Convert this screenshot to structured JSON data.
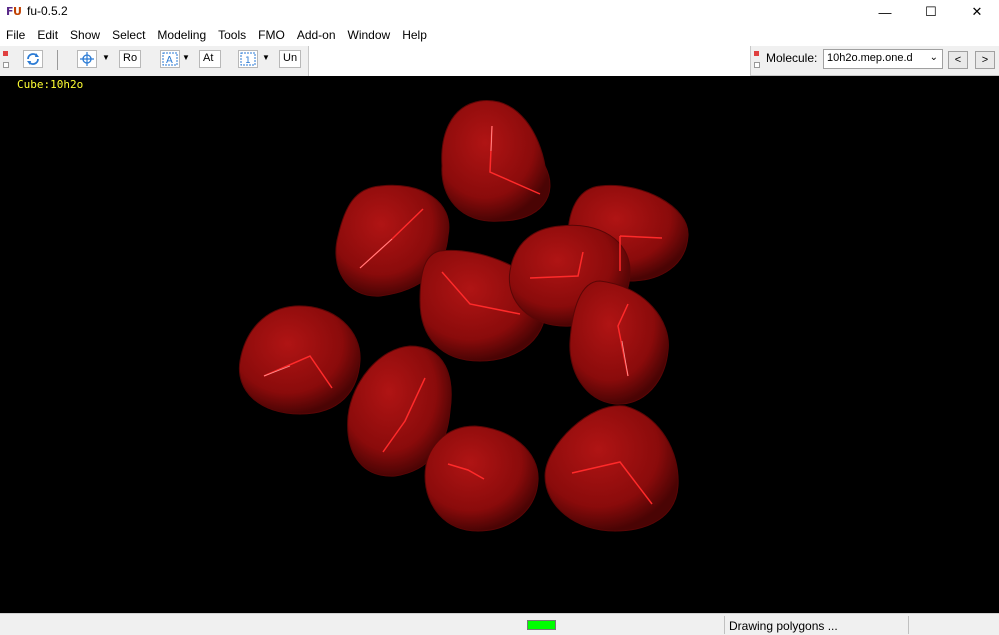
{
  "window": {
    "title": "fu-0.5.2",
    "minimize": "—",
    "maximize": "☐",
    "close": "✕"
  },
  "menu": [
    "File",
    "Edit",
    "Show",
    "Select",
    "Modeling",
    "Tools",
    "FMO",
    "Add-on",
    "Window",
    "Help"
  ],
  "toolbar": {
    "ro_label": "Ro",
    "at_label": "At",
    "un_label": "Un"
  },
  "molecule_bar": {
    "label": "Molecule:",
    "selected": "10h2o.mep.one.d",
    "prev": "<",
    "next": ">"
  },
  "viewport": {
    "cube_label": "Cube:10h2o",
    "surface_color": "#8e0b0b",
    "bond_color": "#ff2a2a"
  },
  "status": {
    "text": "Drawing polygons ...",
    "progress_color": "#00ff00"
  }
}
